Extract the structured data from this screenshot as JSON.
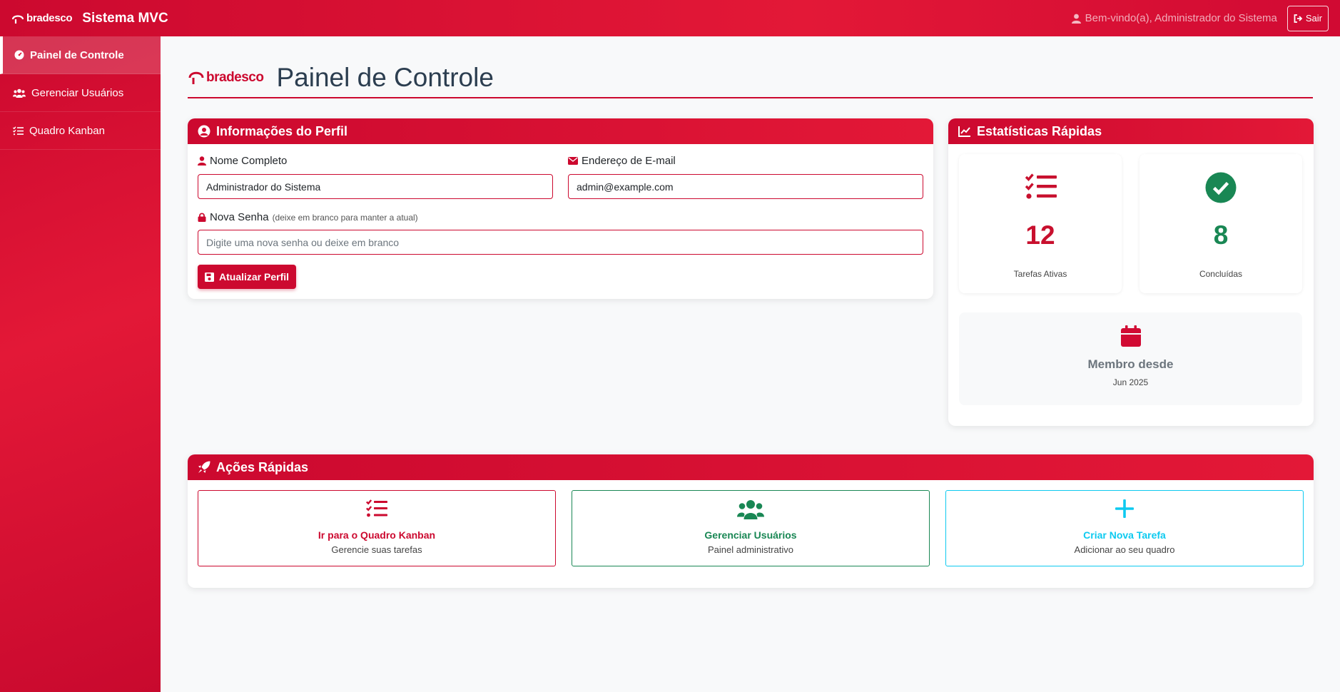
{
  "navbar": {
    "brand_logo": "bradesco",
    "brand_title": "Sistema MVC",
    "welcome": "Bem-vindo(a), Administrador do Sistema",
    "logout_label": "Sair"
  },
  "sidebar": {
    "items": [
      {
        "label": "Painel de Controle",
        "icon": "dashboard-icon",
        "active": true
      },
      {
        "label": "Gerenciar Usuários",
        "icon": "users-icon",
        "active": false
      },
      {
        "label": "Quadro Kanban",
        "icon": "tasks-icon",
        "active": false
      }
    ]
  },
  "header": {
    "logo": "bradesco",
    "title": "Painel de Controle"
  },
  "profile": {
    "title": "Informações do Perfil",
    "name_label": "Nome Completo",
    "name_value": "Administrador do Sistema",
    "email_label": "Endereço de E-mail",
    "email_value": "admin@example.com",
    "password_label": "Nova Senha",
    "password_hint": "(deixe em branco para manter a atual)",
    "password_placeholder": "Digite uma nova senha ou deixe em branco",
    "update_label": "Atualizar Perfil"
  },
  "stats": {
    "title": "Estatísticas Rápidas",
    "active_count": "12",
    "active_label": "Tarefas Ativas",
    "done_count": "8",
    "done_label": "Concluídas",
    "member_label": "Membro desde",
    "member_date": "Jun 2025"
  },
  "actions": {
    "title": "Ações Rápidas",
    "items": [
      {
        "title": "Ir para o Quadro Kanban",
        "subtitle": "Gerencie suas tarefas",
        "color": "#cc092f"
      },
      {
        "title": "Gerenciar Usuários",
        "subtitle": "Painel administrativo",
        "color": "#198754"
      },
      {
        "title": "Criar Nova Tarefa",
        "subtitle": "Adicionar ao seu quadro",
        "color": "#0dcaf0"
      }
    ]
  },
  "colors": {
    "brand": "#cc092f",
    "success": "#198754",
    "info": "#0dcaf0",
    "title_text": "#2c3e50"
  }
}
